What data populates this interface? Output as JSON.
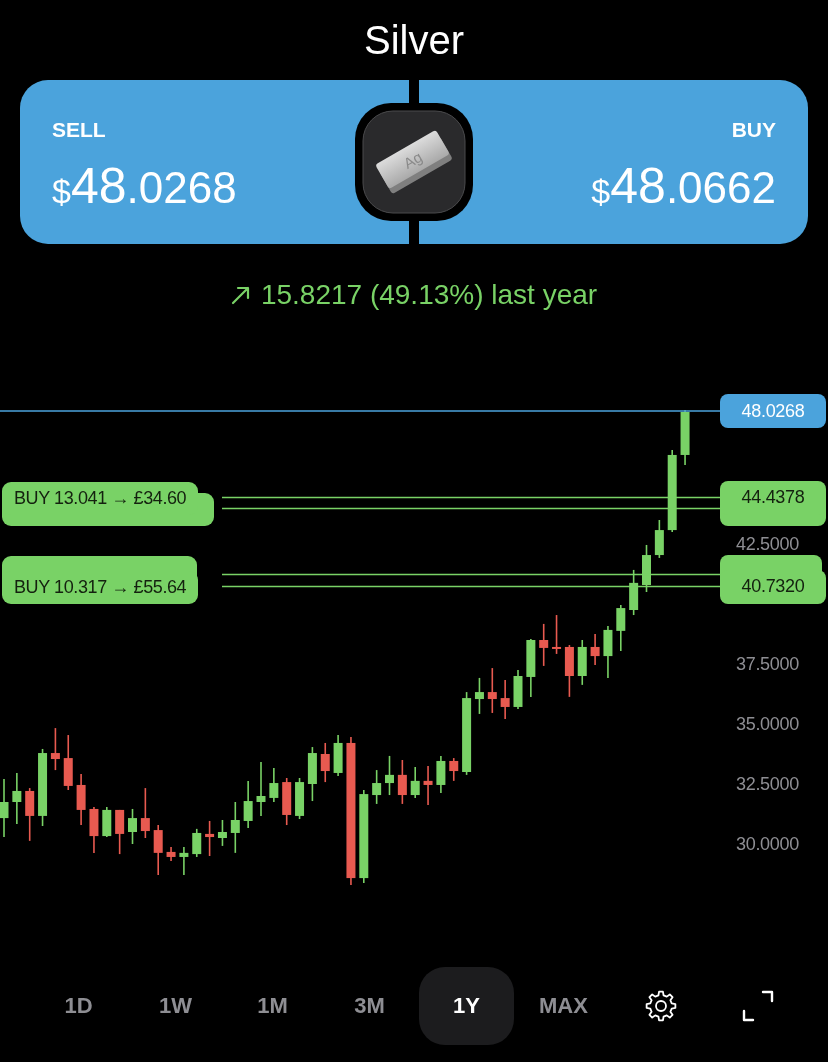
{
  "title": "Silver",
  "quote": {
    "sell": {
      "label": "SELL",
      "currency": "$",
      "integer": "48",
      "decimals": ".0268"
    },
    "buy": {
      "label": "BUY",
      "currency": "$",
      "integer": "48",
      "decimals": ".0662"
    },
    "metal_symbol": "Ag"
  },
  "change": {
    "text": "15.8217 (49.13%) last year"
  },
  "chart": {
    "current_price": "48.0268",
    "orders": [
      {
        "label": "BUY 13.041 → £34.60",
        "price": "44.4378",
        "stacked": true
      },
      {
        "label": "BUY 10.317 → £55.64",
        "price": "40.7320",
        "stacked": true
      }
    ],
    "chart_data": {
      "type": "candlestick",
      "ohlc": [
        [
          31.08,
          32.71,
          30.29,
          31.75
        ],
        [
          31.75,
          32.96,
          30.83,
          32.21
        ],
        [
          32.21,
          32.33,
          30.13,
          31.17
        ],
        [
          31.17,
          33.96,
          30.75,
          33.79
        ],
        [
          33.79,
          34.83,
          33.08,
          33.54
        ],
        [
          33.58,
          34.54,
          32.25,
          32.42
        ],
        [
          32.46,
          32.92,
          30.79,
          31.42
        ],
        [
          31.46,
          31.54,
          29.63,
          30.33
        ],
        [
          30.33,
          31.54,
          30.29,
          31.42
        ],
        [
          31.42,
          31.42,
          29.58,
          30.42
        ],
        [
          30.5,
          31.46,
          30.0,
          31.08
        ],
        [
          31.08,
          32.33,
          30.25,
          30.54
        ],
        [
          30.58,
          30.79,
          28.71,
          29.63
        ],
        [
          29.67,
          29.88,
          29.29,
          29.46
        ],
        [
          29.46,
          29.88,
          28.71,
          29.63
        ],
        [
          29.58,
          30.63,
          29.46,
          30.46
        ],
        [
          30.42,
          30.96,
          29.5,
          30.29
        ],
        [
          30.25,
          31.0,
          29.92,
          30.5
        ],
        [
          30.46,
          31.75,
          29.63,
          31.0
        ],
        [
          30.96,
          32.63,
          30.67,
          31.79
        ],
        [
          31.75,
          33.42,
          31.17,
          32.0
        ],
        [
          31.92,
          33.17,
          31.75,
          32.54
        ],
        [
          32.58,
          32.75,
          30.79,
          31.21
        ],
        [
          31.17,
          32.75,
          31.04,
          32.58
        ],
        [
          32.5,
          34.04,
          31.79,
          33.79
        ],
        [
          33.75,
          34.21,
          32.58,
          33.04
        ],
        [
          32.96,
          34.54,
          32.83,
          34.21
        ],
        [
          34.21,
          34.46,
          28.29,
          28.58
        ],
        [
          28.58,
          32.25,
          28.38,
          32.08
        ],
        [
          32.04,
          33.08,
          31.67,
          32.54
        ],
        [
          32.54,
          33.67,
          32.04,
          32.88
        ],
        [
          32.88,
          33.5,
          31.67,
          32.04
        ],
        [
          32.04,
          33.21,
          31.92,
          32.63
        ],
        [
          32.63,
          33.25,
          31.63,
          32.46
        ],
        [
          32.46,
          33.67,
          32.13,
          33.46
        ],
        [
          33.46,
          33.58,
          32.63,
          33.04
        ],
        [
          33.0,
          36.33,
          32.88,
          36.08
        ],
        [
          36.04,
          36.92,
          35.42,
          36.33
        ],
        [
          36.33,
          37.33,
          35.46,
          36.04
        ],
        [
          36.08,
          36.83,
          35.21,
          35.71
        ],
        [
          35.71,
          37.25,
          35.63,
          37.0
        ],
        [
          36.96,
          38.54,
          36.13,
          38.5
        ],
        [
          38.5,
          39.17,
          37.42,
          38.17
        ],
        [
          38.21,
          39.54,
          37.92,
          38.13
        ],
        [
          38.21,
          38.29,
          36.13,
          37.0
        ],
        [
          37.0,
          38.5,
          36.63,
          38.21
        ],
        [
          38.21,
          38.75,
          37.46,
          37.83
        ],
        [
          37.83,
          39.08,
          36.92,
          38.92
        ],
        [
          38.88,
          39.96,
          38.04,
          39.83
        ],
        [
          39.75,
          41.42,
          39.54,
          40.88
        ],
        [
          40.79,
          42.46,
          40.5,
          42.04
        ],
        [
          42.04,
          43.5,
          41.92,
          43.08
        ],
        [
          43.08,
          46.42,
          43.0,
          46.21
        ],
        [
          46.21,
          48.08,
          45.79,
          48.0
        ]
      ],
      "ylim": [
        30.0,
        42.5
      ],
      "yticks": [
        {
          "value": 42.5,
          "label": "42.5000"
        },
        {
          "value": 37.5,
          "label": "37.5000"
        },
        {
          "value": 35.0,
          "label": "35.0000"
        },
        {
          "value": 32.5,
          "label": "32.5000"
        },
        {
          "value": 30.0,
          "label": "30.0000"
        }
      ]
    }
  },
  "ranges": [
    {
      "label": "1D",
      "selected": false
    },
    {
      "label": "1W",
      "selected": false
    },
    {
      "label": "1M",
      "selected": false
    },
    {
      "label": "3M",
      "selected": false
    },
    {
      "label": "1Y",
      "selected": true
    },
    {
      "label": "MAX",
      "selected": false
    }
  ]
}
